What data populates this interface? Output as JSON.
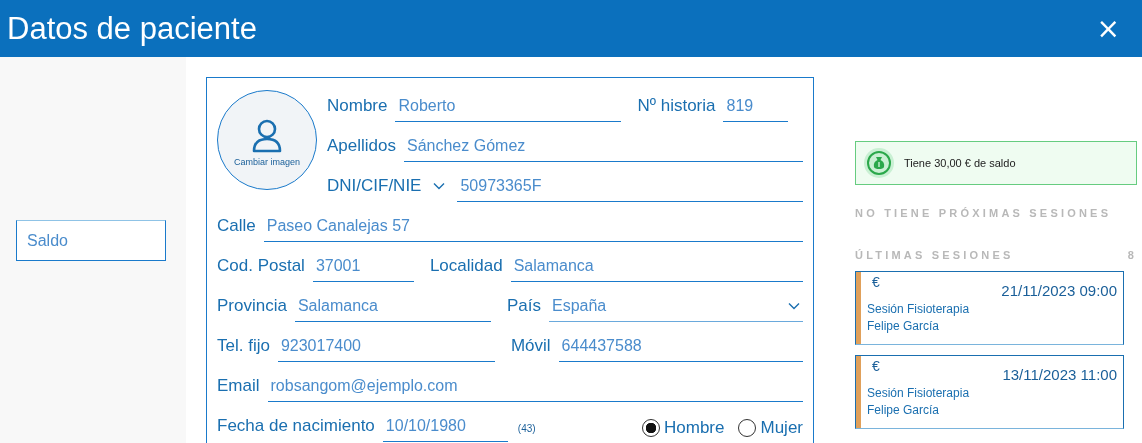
{
  "window": {
    "title": "Datos de paciente",
    "close": "×"
  },
  "sidebar": {
    "buttons": [
      "Saldo"
    ]
  },
  "patient_form": {
    "avatar_button": "Cambiar imagen",
    "rows": [
      [
        {
          "kind": "text",
          "label": "Nombre",
          "value": "Roberto"
        },
        {
          "kind": "text",
          "label": "Nº historia",
          "value": "819"
        }
      ],
      [
        {
          "kind": "text",
          "label": "Apellidos",
          "value": "Sánchez Gómez"
        }
      ],
      [
        {
          "kind": "id_select",
          "label": "DNI/CIF/NIE",
          "value": "50973365F"
        }
      ],
      [
        {
          "kind": "text",
          "label": "Calle",
          "value": "Paseo Canalejas 57"
        }
      ],
      [
        {
          "kind": "text",
          "label": "Cod. Postal",
          "value": "37001"
        },
        {
          "kind": "text",
          "label": "Localidad",
          "value": "Salamanca"
        }
      ],
      [
        {
          "kind": "text",
          "label": "Provincia",
          "value": "Salamanca"
        },
        {
          "kind": "select",
          "label": "País",
          "value": "España"
        }
      ],
      [
        {
          "kind": "text",
          "label": "Tel. fijo",
          "value": "923017400"
        },
        {
          "kind": "text",
          "label": "Móvil",
          "value": "644437588"
        }
      ],
      [
        {
          "kind": "text",
          "label": "Email",
          "value": "robsangom@ejemplo.com"
        }
      ],
      [
        {
          "kind": "date",
          "label": "Fecha de nacimiento",
          "value": "10/10/1980",
          "note": "(43)"
        },
        {
          "kind": "radio",
          "options": [
            {
              "label": "Hombre",
              "selected": true
            },
            {
              "label": "Mujer",
              "selected": false
            }
          ]
        }
      ]
    ]
  },
  "right_panel": {
    "balance": "Tiene 30,00 € de saldo",
    "upcoming": "NO TIENE PRÓXIMAS SESIONES",
    "recent_title": "ÚLTIMAS SESIONES",
    "recent_count": "8",
    "sessions": [
      {
        "icon": "€",
        "datetime": "21/11/2023 09:00",
        "service": "Sesión Fisioterapia",
        "professional": "Felipe García",
        "color": "#e0a05a"
      },
      {
        "icon": "€",
        "datetime": "13/11/2023 11:00",
        "service": "Sesión Fisioterapia",
        "professional": "Felipe García",
        "color": "#e0a05a"
      }
    ]
  }
}
